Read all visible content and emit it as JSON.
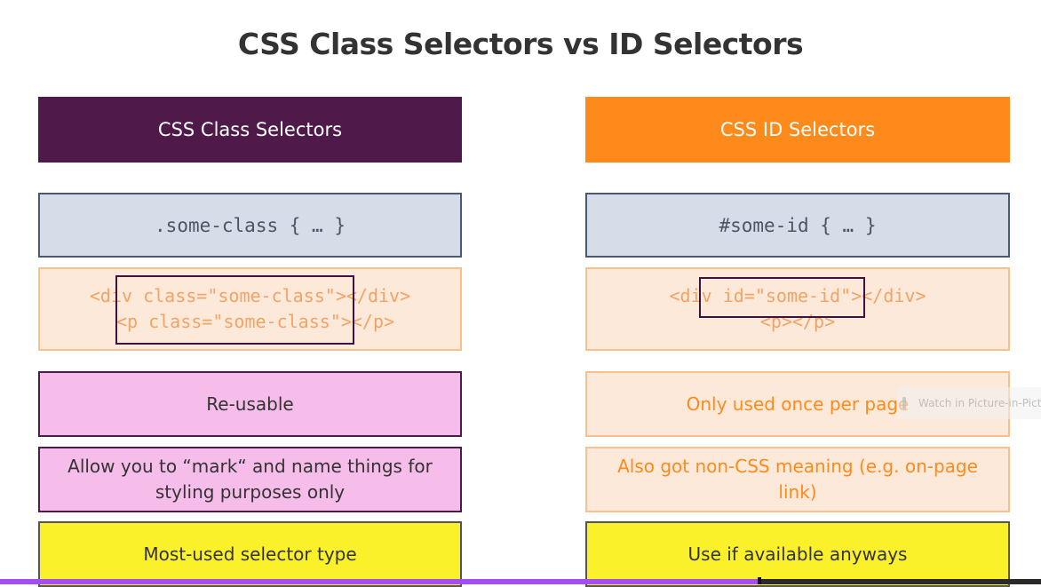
{
  "slide": {
    "title": "CSS Class Selectors vs ID Selectors"
  },
  "left": {
    "header": "CSS Class Selectors",
    "selector": ".some-class { … }",
    "code_line1_a": "<div ",
    "code_line1_b": "class=\"some-class\"",
    "code_line1_c": "></div>",
    "code_line2_a": "<p ",
    "code_line2_b": "class=\"some-class\"",
    "code_line2_c": "></p>",
    "point1": "Re-usable",
    "point2": "Allow you to “mark“ and name things for styling purposes only",
    "point3": "Most-used selector type"
  },
  "right": {
    "header": "CSS ID Selectors",
    "selector": "#some-id { … }",
    "code_line1_a": "<div ",
    "code_line1_b": "id=\"some-id\"",
    "code_line1_c": "></div>",
    "code_line2": "<p></p>",
    "point1": "Only used once per page",
    "point2": "Also got non-CSS meaning (e.g. on-page link)",
    "point3": "Use if available anyways"
  },
  "player": {
    "pip_label": "Watch in Picture-in-Picture",
    "progress_fraction": 0.73
  },
  "colors": {
    "class_header": "#4f1a4a",
    "id_header": "#ff8a1c",
    "progress": "#a64df2"
  }
}
